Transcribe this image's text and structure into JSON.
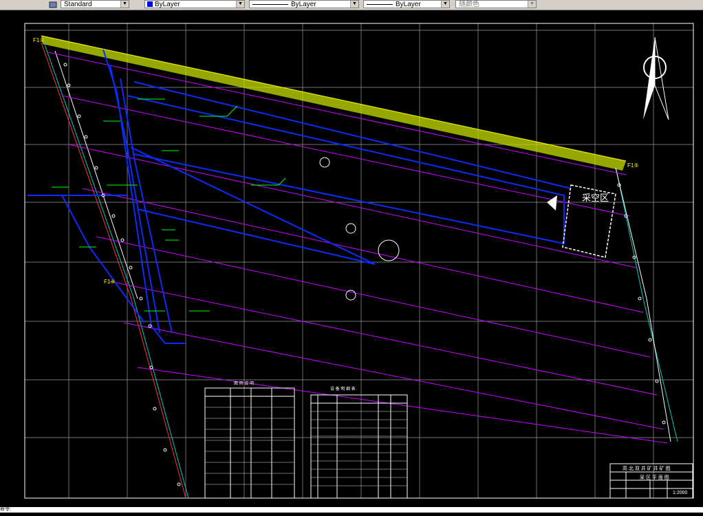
{
  "toolbar": {
    "textstyle": "Standard",
    "layer_color": "ByLayer",
    "linetype": "ByLayer",
    "lineweight": "ByLayer",
    "plotstyle": "随颜色",
    "color_swatch": "#0000ff"
  },
  "drawing": {
    "fault_labels": [
      "F1①",
      "F1⑤",
      "F1④"
    ],
    "zone_label": "采空区",
    "title_block": {
      "title": "高 北 双 井 矿 井 矿 图",
      "subtitle": "采 区 平 面 图",
      "scale": "1:2000"
    },
    "legend_title": "图 例 说 明",
    "table_title": "设 备 明 细 表",
    "colors": {
      "background": "#000000",
      "roadway": "#0000ff",
      "label": "#00ff00",
      "boundary": "#cc00ff",
      "fault": "#ffff00",
      "grid": "#ffffff"
    }
  },
  "command_line": "命令:"
}
